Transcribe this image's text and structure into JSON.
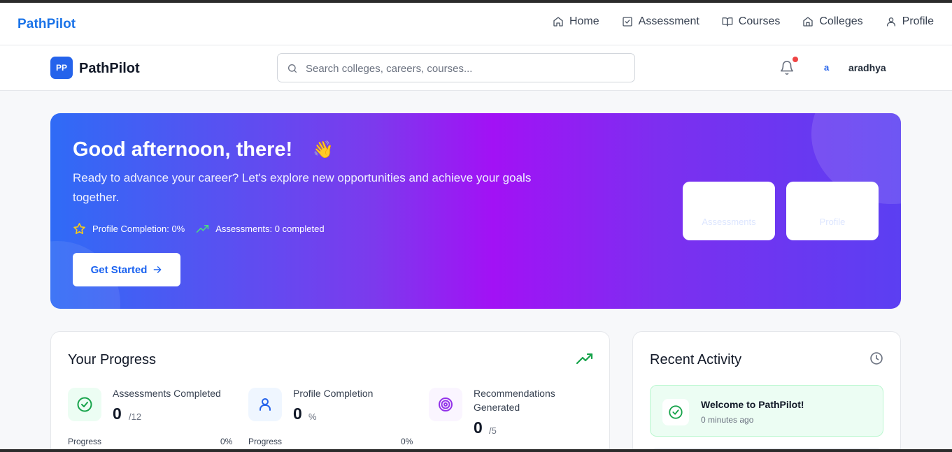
{
  "topnav": {
    "brand": "PathPilot",
    "links": [
      {
        "label": "Home",
        "icon": "home-icon"
      },
      {
        "label": "Assessment",
        "icon": "check-square-icon"
      },
      {
        "label": "Courses",
        "icon": "book-open-icon"
      },
      {
        "label": "Colleges",
        "icon": "building-icon"
      },
      {
        "label": "Profile",
        "icon": "user-icon"
      }
    ]
  },
  "appbar": {
    "logo_badge": "PP",
    "logo_text": "PathPilot",
    "search_placeholder": "Search colleges, careers, courses...",
    "avatar_initial": "a",
    "username": "aradhya"
  },
  "hero": {
    "title": "Good afternoon, there!",
    "emoji": "👋",
    "subtitle": "Ready to advance your career? Let's explore new opportunities and achieve your goals together.",
    "stat_profile": "Profile Completion: 0%",
    "stat_assessments": "Assessments: 0 completed",
    "button": "Get Started",
    "card_assessments": "Assessments",
    "card_profile": "Profile",
    "colors": {
      "start": "#2f6bf6",
      "mid": "#a211f5",
      "end": "#5b3ff2"
    }
  },
  "progress": {
    "title": "Your Progress",
    "stats": [
      {
        "label": "Assessments Completed",
        "value": "0",
        "unit": "/12",
        "bar_label": "Progress",
        "bar_pct": "0%"
      },
      {
        "label": "Profile Completion",
        "value": "0",
        "unit": "%",
        "bar_label": "Progress",
        "bar_pct": "0%"
      },
      {
        "label": "Recommendations Generated",
        "value": "0",
        "unit": "/5"
      }
    ]
  },
  "activity": {
    "title": "Recent Activity",
    "items": [
      {
        "title": "Welcome to PathPilot!",
        "time": "0 minutes ago"
      }
    ]
  }
}
